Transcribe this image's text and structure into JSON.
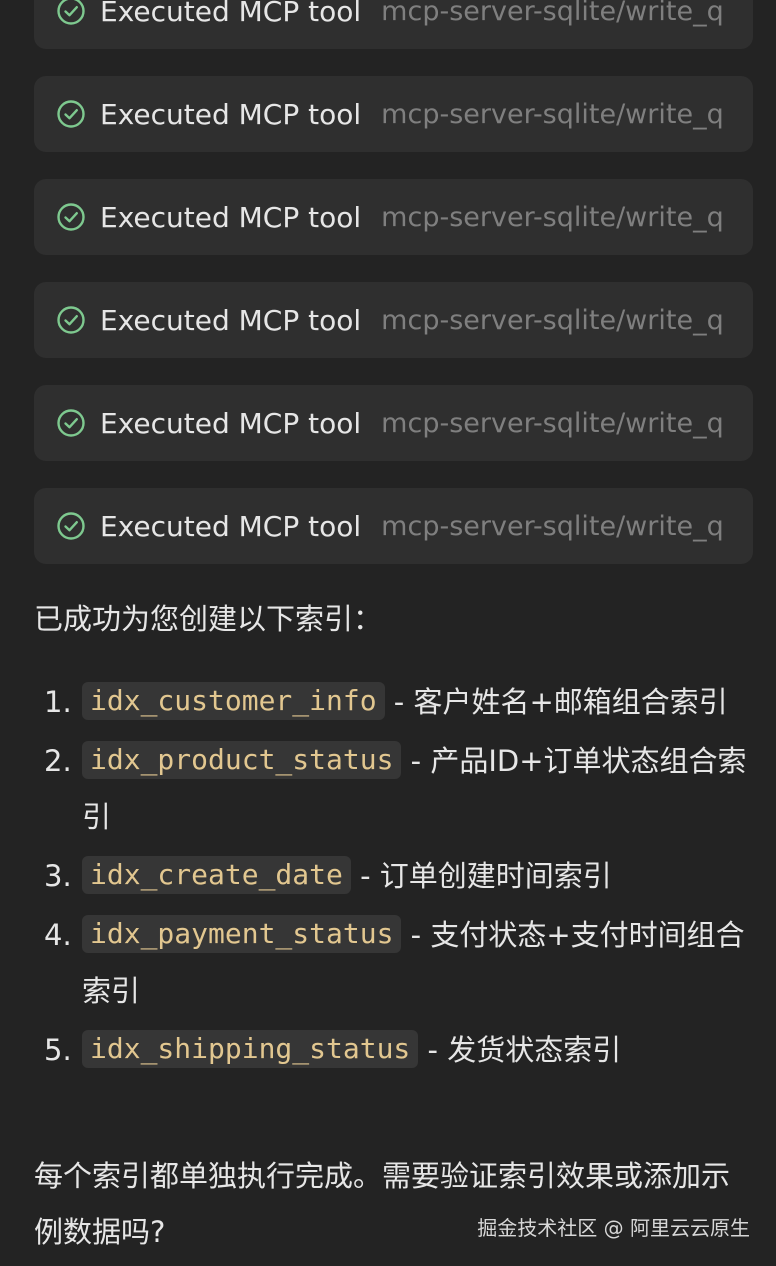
{
  "tool_calls": [
    {
      "label": "Executed MCP tool",
      "path": "mcp-server-sqlite/write_q",
      "status": "success"
    },
    {
      "label": "Executed MCP tool",
      "path": "mcp-server-sqlite/write_q",
      "status": "success"
    },
    {
      "label": "Executed MCP tool",
      "path": "mcp-server-sqlite/write_q",
      "status": "success"
    },
    {
      "label": "Executed MCP tool",
      "path": "mcp-server-sqlite/write_q",
      "status": "success"
    },
    {
      "label": "Executed MCP tool",
      "path": "mcp-server-sqlite/write_q",
      "status": "success"
    },
    {
      "label": "Executed MCP tool",
      "path": "mcp-server-sqlite/write_q",
      "status": "success"
    }
  ],
  "summary": "已成功为您创建以下索引：",
  "indexes": [
    {
      "num": "1.",
      "name": "idx_customer_info",
      "desc": " - 客户姓名+邮箱组合索引"
    },
    {
      "num": "2.",
      "name": "idx_product_status",
      "desc": " - 产品ID+订单状态组合索引"
    },
    {
      "num": "3.",
      "name": "idx_create_date",
      "desc": " - 订单创建时间索引"
    },
    {
      "num": "4.",
      "name": "idx_payment_status",
      "desc": " - 支付状态+支付时间组合索引"
    },
    {
      "num": "5.",
      "name": "idx_shipping_status",
      "desc": " - 发货状态索引"
    }
  ],
  "footer": "每个索引都单独执行完成。需要验证索引效果或添加示例数据吗?",
  "watermark": "掘金技术社区 @ 阿里云云原生",
  "colors": {
    "background": "#232323",
    "card": "#2f2f2f",
    "check": "#7ec98f",
    "code_text": "#e2c790",
    "code_bg": "#363636",
    "muted": "#7f7f7f"
  },
  "icons": {
    "tool_status": "check-circle-icon"
  }
}
